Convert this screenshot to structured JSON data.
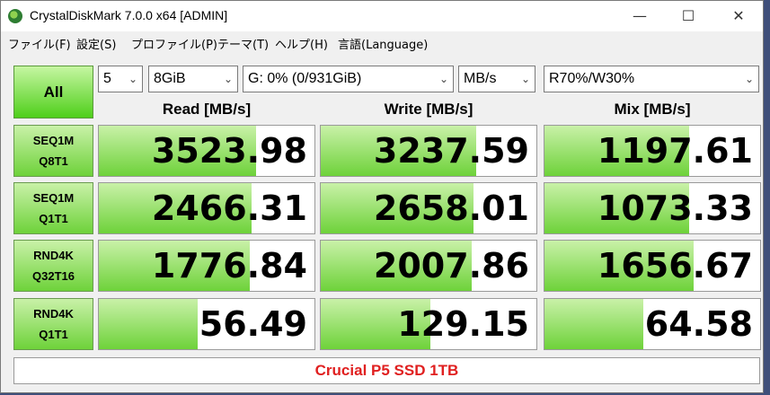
{
  "window": {
    "title": "CrystalDiskMark 7.0.0 x64 [ADMIN]",
    "controls": {
      "minimize": "—",
      "maximize": "☐",
      "close": "✕"
    }
  },
  "menu": [
    "ファイル(F)",
    "設定(S)",
    "プロファイル(P)",
    "テーマ(T)",
    "ヘルプ(H)",
    "言語(Language)"
  ],
  "toolbar": {
    "all_label": "All",
    "count": "5",
    "size": "8GiB",
    "drive": "G: 0% (0/931GiB)",
    "unit": "MB/s",
    "mix": "R70%/W30%",
    "arrow": "⌄"
  },
  "headers": {
    "read": "Read [MB/s]",
    "write": "Write [MB/s]",
    "mix": "Mix [MB/s]"
  },
  "rows": [
    {
      "line1": "SEQ1M",
      "line2": "Q8T1",
      "read": "3523.98",
      "write": "3237.59",
      "mix": "1197.61",
      "read_fill": 0.73,
      "write_fill": 0.72,
      "mix_fill": 0.67
    },
    {
      "line1": "SEQ1M",
      "line2": "Q1T1",
      "read": "2466.31",
      "write": "2658.01",
      "mix": "1073.33",
      "read_fill": 0.71,
      "write_fill": 0.71,
      "mix_fill": 0.67
    },
    {
      "line1": "RND4K",
      "line2": "Q32T16",
      "read": "1776.84",
      "write": "2007.86",
      "mix": "1656.67",
      "read_fill": 0.7,
      "write_fill": 0.7,
      "mix_fill": 0.69
    },
    {
      "line1": "RND4K",
      "line2": "Q1T1",
      "read": "56.49",
      "write": "129.15",
      "mix": "64.58",
      "read_fill": 0.46,
      "write_fill": 0.51,
      "mix_fill": 0.46
    }
  ],
  "comment": "Crucial P5 SSD 1TB",
  "colors": {
    "bar_top": "#c9f1a8",
    "bar_bottom": "#6ed23a",
    "comment_text": "#e02020"
  }
}
